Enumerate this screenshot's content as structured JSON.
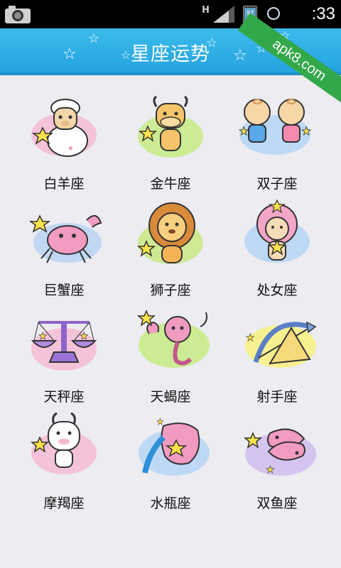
{
  "status_bar": {
    "network_type": "H",
    "battery_level": "97",
    "time": ":33",
    "icons": [
      "camera-icon",
      "signal-icon",
      "battery-icon",
      "alarm-clock-icon"
    ]
  },
  "watermark": "apk8.com",
  "header": {
    "title": "星座运势"
  },
  "colors": {
    "header": "#2aaae4",
    "background": "#ececf1",
    "watermark": "#33a84a"
  },
  "signs": [
    {
      "label": "白羊座",
      "icon": "aries-sheep-icon",
      "glow": "#f6b9d3"
    },
    {
      "label": "金牛座",
      "icon": "taurus-bull-icon",
      "glow": "#c9ec8a"
    },
    {
      "label": "双子座",
      "icon": "gemini-twins-icon",
      "glow": "#b9d7f6"
    },
    {
      "label": "巨蟹座",
      "icon": "cancer-crab-icon",
      "glow": "#bcd5f4"
    },
    {
      "label": "狮子座",
      "icon": "leo-lion-icon",
      "glow": "#cde98a"
    },
    {
      "label": "处女座",
      "icon": "virgo-girl-icon",
      "glow": "#b9d7f6"
    },
    {
      "label": "天秤座",
      "icon": "libra-scales-icon",
      "glow": "#f6b9d3"
    },
    {
      "label": "天蝎座",
      "icon": "scorpio-scorpion-icon",
      "glow": "#c9ec8a"
    },
    {
      "label": "射手座",
      "icon": "sagittarius-bow-icon",
      "glow": "#f8f08a"
    },
    {
      "label": "摩羯座",
      "icon": "capricorn-goat-icon",
      "glow": "#f6b9d3"
    },
    {
      "label": "水瓶座",
      "icon": "aquarius-jar-icon",
      "glow": "#b9d7f6"
    },
    {
      "label": "双鱼座",
      "icon": "pisces-fish-icon",
      "glow": "#d4c2ef"
    }
  ]
}
